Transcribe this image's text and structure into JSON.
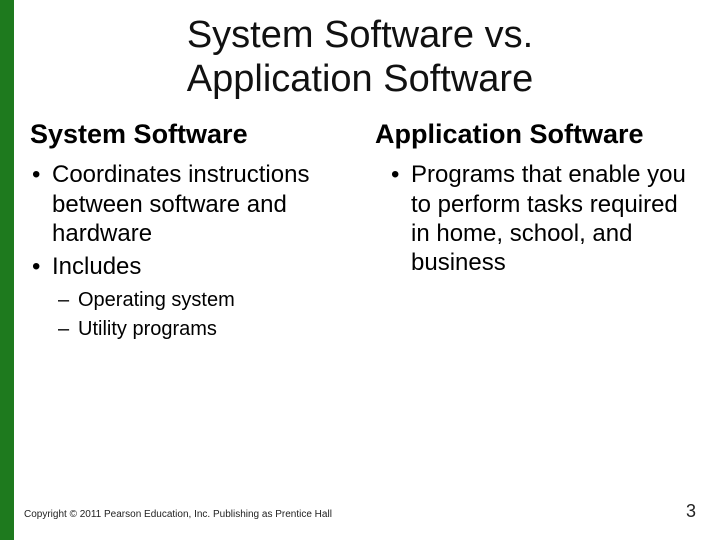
{
  "title_line1": "System Software vs.",
  "title_line2": "Application Software",
  "columns": {
    "left": {
      "heading": "System Software",
      "bullets": [
        {
          "text": "Coordinates instructions between software and hardware"
        },
        {
          "text": "Includes",
          "sub": [
            "Operating system",
            "Utility programs"
          ]
        }
      ]
    },
    "right": {
      "heading": "Application Software",
      "bullets": [
        {
          "text": "Programs that enable you to perform tasks required in home, school, and business"
        }
      ]
    }
  },
  "footer": "Copyright © 2011 Pearson Education, Inc. Publishing as Prentice Hall",
  "page_number": "3"
}
